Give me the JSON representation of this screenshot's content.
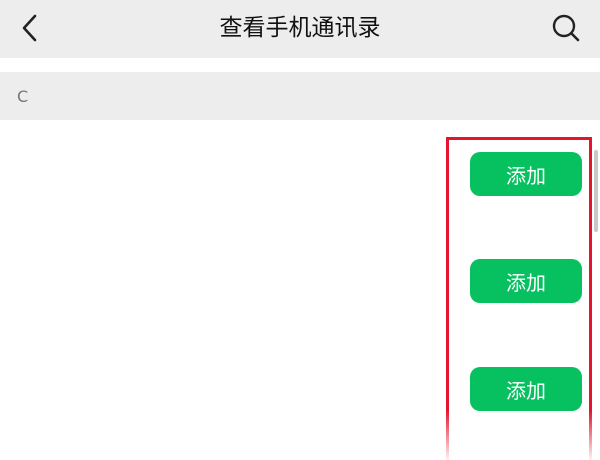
{
  "header": {
    "title": "查看手机通讯录",
    "back_icon": "chevron-left-icon",
    "search_icon": "search-icon"
  },
  "section": {
    "letter": "C"
  },
  "contacts": [
    {
      "add_label": "添加"
    },
    {
      "add_label": "添加"
    },
    {
      "add_label": "添加"
    }
  ],
  "colors": {
    "accent_green": "#07c160",
    "highlight_red": "#e3142b",
    "header_bg": "#ededed"
  }
}
